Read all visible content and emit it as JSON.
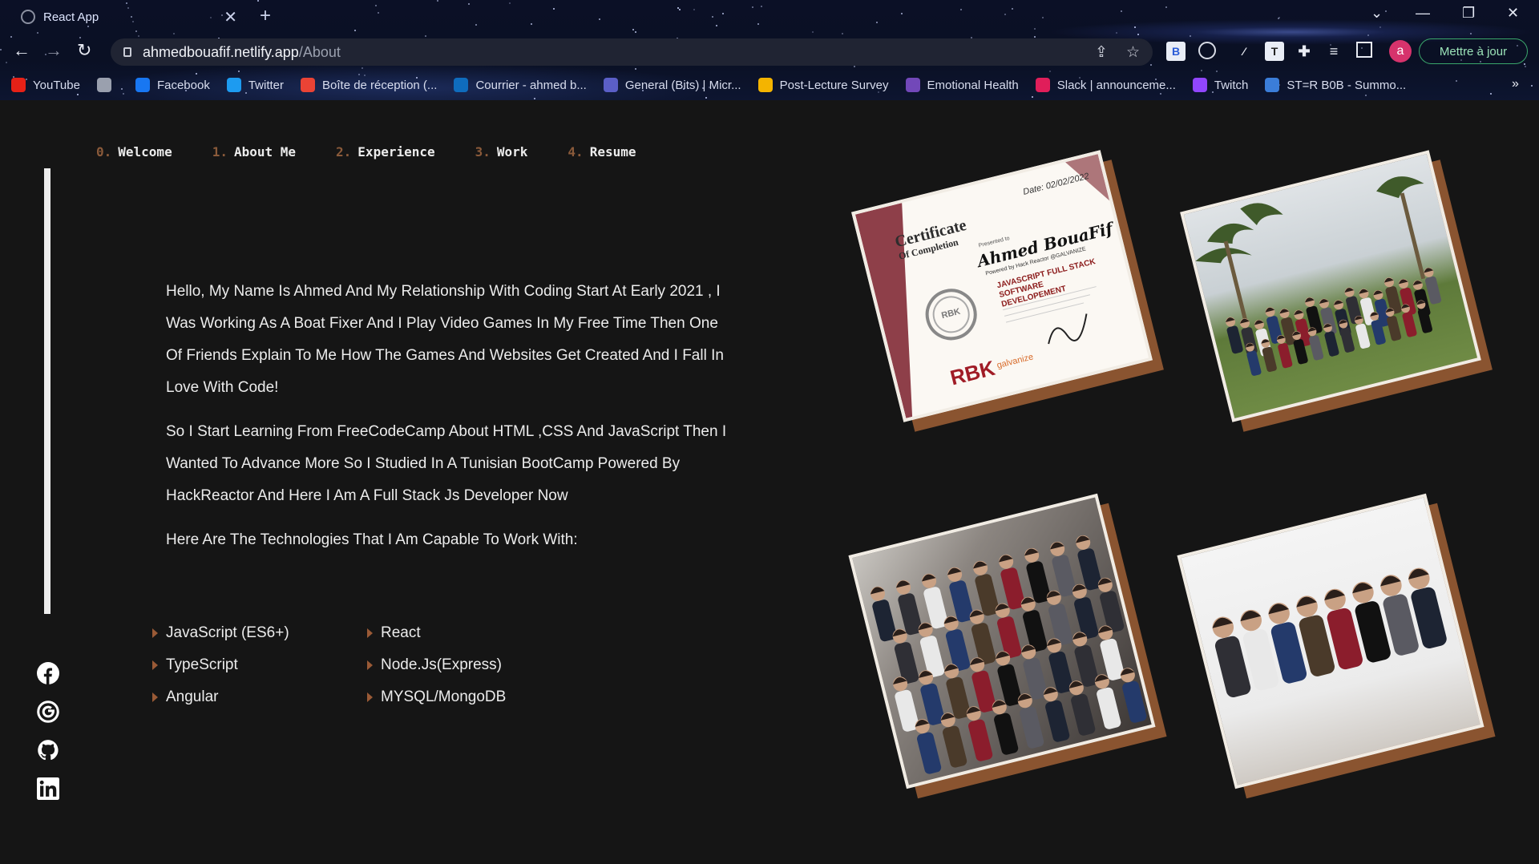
{
  "browser": {
    "tab_title": "React App",
    "url_host": "ahmedbouafif.netlify.app",
    "url_path": "/About",
    "avatar_letter": "a",
    "update_label": "Mettre à jour",
    "bookmarks": [
      {
        "label": "YouTube",
        "icon": "youtube-icon",
        "color": "#e62117"
      },
      {
        "label": "",
        "icon": "globe-icon",
        "color": "#9aa0ae"
      },
      {
        "label": "Facebook",
        "icon": "facebook-icon",
        "color": "#1877f2"
      },
      {
        "label": "Twitter",
        "icon": "twitter-icon",
        "color": "#1d9bf0"
      },
      {
        "label": "Boîte de réception (...",
        "icon": "gmail-icon",
        "color": "#ea4335"
      },
      {
        "label": "Courrier - ahmed b...",
        "icon": "outlook-icon",
        "color": "#0f6cbd"
      },
      {
        "label": "General (Bits) | Micr...",
        "icon": "teams-icon",
        "color": "#5b5fc7"
      },
      {
        "label": "Post-Lecture Survey",
        "icon": "drive-icon",
        "color": "#f4b400"
      },
      {
        "label": "Emotional Health",
        "icon": "forms-icon",
        "color": "#7248b9"
      },
      {
        "label": "Slack | announceme...",
        "icon": "slack-icon",
        "color": "#e01e5a"
      },
      {
        "label": "Twitch",
        "icon": "twitch-icon",
        "color": "#9146ff"
      },
      {
        "label": "ST=R B0B - Summo...",
        "icon": "opgg-icon",
        "color": "#3b7dd8"
      }
    ]
  },
  "nav": [
    {
      "num": "0.",
      "label": "Welcome"
    },
    {
      "num": "1.",
      "label": "About Me"
    },
    {
      "num": "2.",
      "label": "Experience"
    },
    {
      "num": "3.",
      "label": "Work"
    },
    {
      "num": "4.",
      "label": "Resume"
    }
  ],
  "about": {
    "p1": "Hello, My Name Is Ahmed And My Relationship With Coding Start At Early 2021 , I Was Working As A Boat Fixer And I Play Video Games In My Free Time Then One Of Friends Explain To Me How The Games And Websites Get Created And I Fall In Love With Code!",
    "p2": "So I Start Learning From FreeCodeCamp About HTML ,CSS And JavaScript Then I Wanted To Advance More So I Studied In A Tunisian BootCamp Powered By HackReactor And Here I Am A Full Stack Js Developer Now",
    "p3": "Here Are The Technologies That I Am Capable To Work With:"
  },
  "technologies": [
    "JavaScript (ES6+)",
    "React",
    "TypeScript",
    "Node.Js(Express)",
    "Angular",
    "MYSQL/MongoDB"
  ],
  "certificate": {
    "heading": "Certificate",
    "subheading": "Of Completion",
    "date": "Date: 02/02/2022",
    "presented_to": "Presented to",
    "name": "Ahmed BouaFif",
    "course": "JAVASCRIPT FULL STACK SOFTWARE DEVELOPEMENT",
    "powered": "Powered by Hack Reactor @GALVANIZE",
    "logo": "RBK",
    "seal": "RBK",
    "partner": "galvanize"
  },
  "socials": [
    "facebook-icon",
    "google-icon",
    "github-icon",
    "linkedin-icon"
  ],
  "colors": {
    "accent": "#8a5430",
    "nav_number": "#8a5a3a",
    "background": "#151515"
  }
}
